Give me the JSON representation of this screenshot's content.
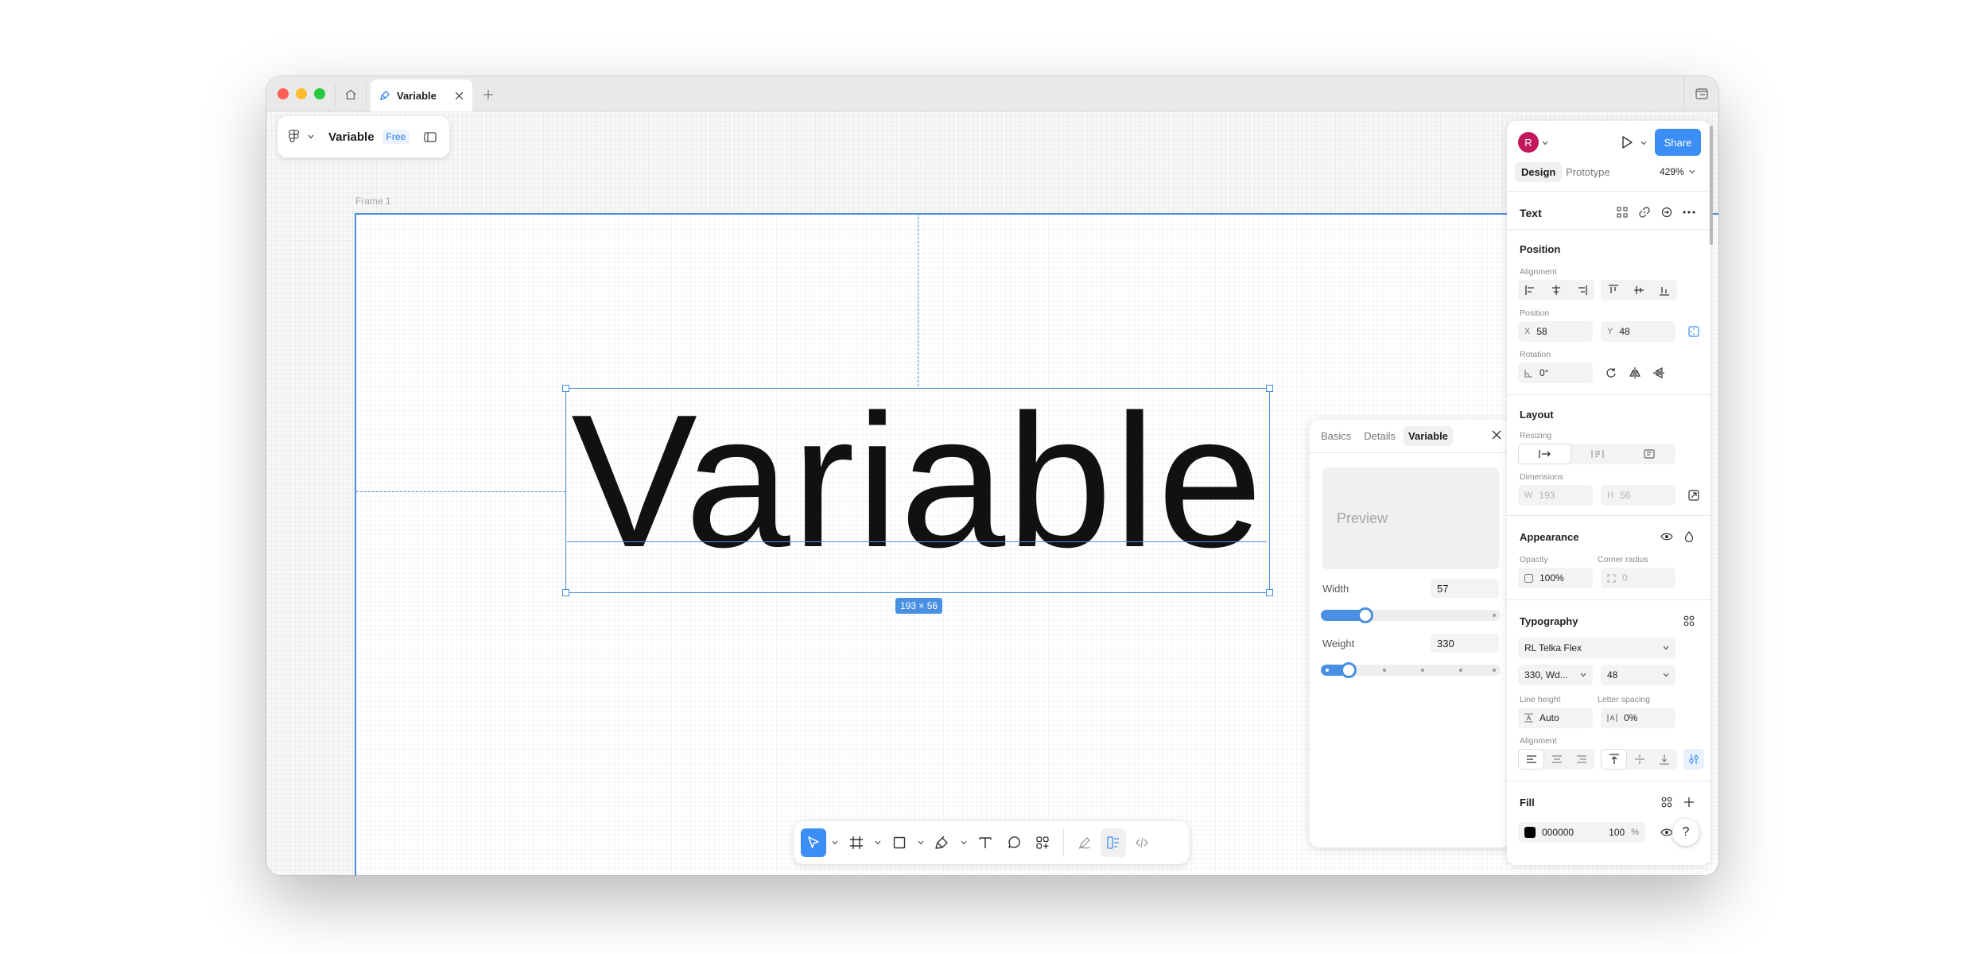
{
  "tab": {
    "title": "Variable"
  },
  "file": {
    "name": "Variable",
    "plan_badge": "Free"
  },
  "canvas": {
    "frame_label": "Frame 1",
    "text_content": "Variable",
    "dimension_badge": "193 × 56"
  },
  "variable_panel": {
    "tabs": [
      "Basics",
      "Details",
      "Variable"
    ],
    "active_tab": "Variable",
    "preview_label": "Preview",
    "axes": [
      {
        "label": "Width",
        "value": "57",
        "fraction": 0.22
      },
      {
        "label": "Weight",
        "value": "330",
        "fraction": 0.13
      }
    ]
  },
  "props": {
    "avatar_initial": "R",
    "share_label": "Share",
    "mode_tabs": [
      "Design",
      "Prototype"
    ],
    "zoom": "429%",
    "layer_type": "Text",
    "position": {
      "title": "Position",
      "alignment_label": "Alignment",
      "position_label": "Position",
      "x_prefix": "X",
      "x_value": "58",
      "y_prefix": "Y",
      "y_value": "48",
      "rotation_label": "Rotation",
      "rotation_value": "0°"
    },
    "layout": {
      "title": "Layout",
      "resizing_label": "Resizing",
      "dimensions_label": "Dimensions",
      "w_prefix": "W",
      "w_value": "193",
      "h_prefix": "H",
      "h_value": "56"
    },
    "appearance": {
      "title": "Appearance",
      "opacity_label": "Opacity",
      "opacity_value": "100%",
      "radius_label": "Corner radius",
      "radius_value": "0"
    },
    "typography": {
      "title": "Typography",
      "font_family": "RL Telka Flex",
      "font_style": "330, Wd...",
      "font_size": "48",
      "line_height_label": "Line height",
      "line_height_value": "Auto",
      "letter_spacing_label": "Letter spacing",
      "letter_spacing_value": "0%",
      "alignment_label": "Alignment"
    },
    "fill": {
      "title": "Fill",
      "hex": "000000",
      "opacity": "100",
      "percent": "%",
      "swatch_color": "#000000"
    },
    "help_label": "?"
  },
  "colors": {
    "accent": "#3b8ef5",
    "selection": "#4a90e2",
    "avatar": "#c2185b"
  }
}
